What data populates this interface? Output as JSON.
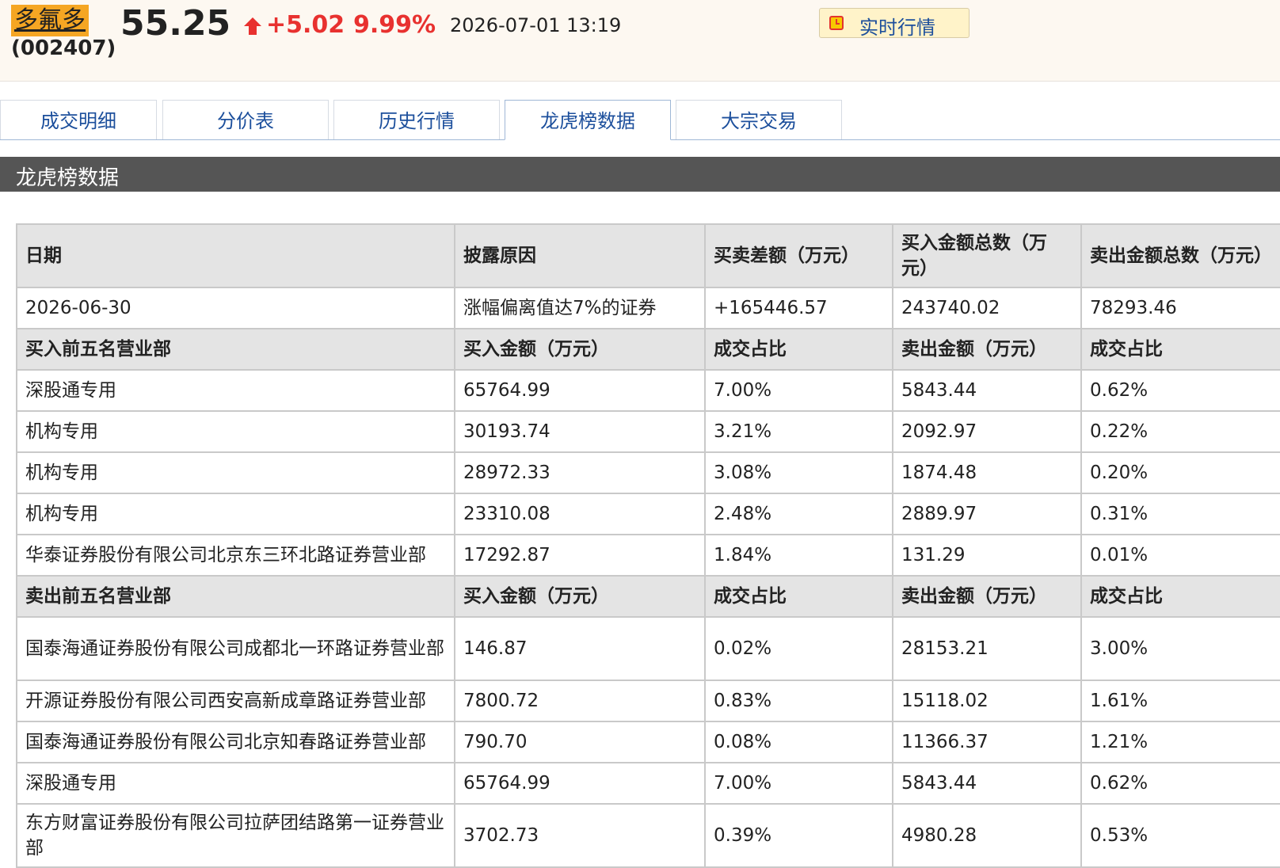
{
  "stock": {
    "name": "多氟多",
    "code": "(002407)",
    "price": "55.25",
    "change": "+5.02",
    "change_pct": "9.99%",
    "datetime": "2026-07-01 13:19",
    "realtime_label": "实时行情"
  },
  "tabs": [
    {
      "label": "成交明细",
      "active": false
    },
    {
      "label": "分价表",
      "active": false
    },
    {
      "label": "历史行情",
      "active": false
    },
    {
      "label": "龙虎榜数据",
      "active": true
    },
    {
      "label": "大宗交易",
      "active": false
    }
  ],
  "section_title": "龙虎榜数据",
  "table": {
    "columns": [
      "日期",
      "披露原因",
      "买卖差额（万元）",
      "买入金额总数（万元）",
      "卖出金额总数（万元）"
    ],
    "summary": {
      "date": "2026-06-30",
      "reason": "涨幅偏离值达7%的证券",
      "net": "+165446.57",
      "buy_total": "243740.02",
      "sell_total": "78293.46"
    },
    "buy_header": [
      "买入前五名营业部",
      "买入金额（万元）",
      "成交占比",
      "卖出金额（万元）",
      "成交占比"
    ],
    "buy_rows": [
      {
        "name": "深股通专用",
        "buy": "65764.99",
        "buy_pct": "7.00%",
        "sell": "5843.44",
        "sell_pct": "0.62%"
      },
      {
        "name": "机构专用",
        "buy": "30193.74",
        "buy_pct": "3.21%",
        "sell": "2092.97",
        "sell_pct": "0.22%"
      },
      {
        "name": "机构专用",
        "buy": "28972.33",
        "buy_pct": "3.08%",
        "sell": "1874.48",
        "sell_pct": "0.20%"
      },
      {
        "name": "机构专用",
        "buy": "23310.08",
        "buy_pct": "2.48%",
        "sell": "2889.97",
        "sell_pct": "0.31%"
      },
      {
        "name": "华泰证券股份有限公司北京东三环北路证券营业部",
        "buy": "17292.87",
        "buy_pct": "1.84%",
        "sell": "131.29",
        "sell_pct": "0.01%"
      }
    ],
    "sell_header": [
      "卖出前五名营业部",
      "买入金额（万元）",
      "成交占比",
      "卖出金额（万元）",
      "成交占比"
    ],
    "sell_rows": [
      {
        "name": "国泰海通证券股份有限公司成都北一环路证券营业部",
        "buy": "146.87",
        "buy_pct": "0.02%",
        "sell": "28153.21",
        "sell_pct": "3.00%"
      },
      {
        "name": "开源证券股份有限公司西安高新成章路证券营业部",
        "buy": "7800.72",
        "buy_pct": "0.83%",
        "sell": "15118.02",
        "sell_pct": "1.61%"
      },
      {
        "name": "国泰海通证券股份有限公司北京知春路证券营业部",
        "buy": "790.70",
        "buy_pct": "0.08%",
        "sell": "11366.37",
        "sell_pct": "1.21%"
      },
      {
        "name": "深股通专用",
        "buy": "65764.99",
        "buy_pct": "7.00%",
        "sell": "5843.44",
        "sell_pct": "0.62%"
      },
      {
        "name": "东方财富证券股份有限公司拉萨团结路第一证券营业部",
        "buy": "3702.73",
        "buy_pct": "0.39%",
        "sell": "4980.28",
        "sell_pct": "0.53%"
      }
    ]
  }
}
